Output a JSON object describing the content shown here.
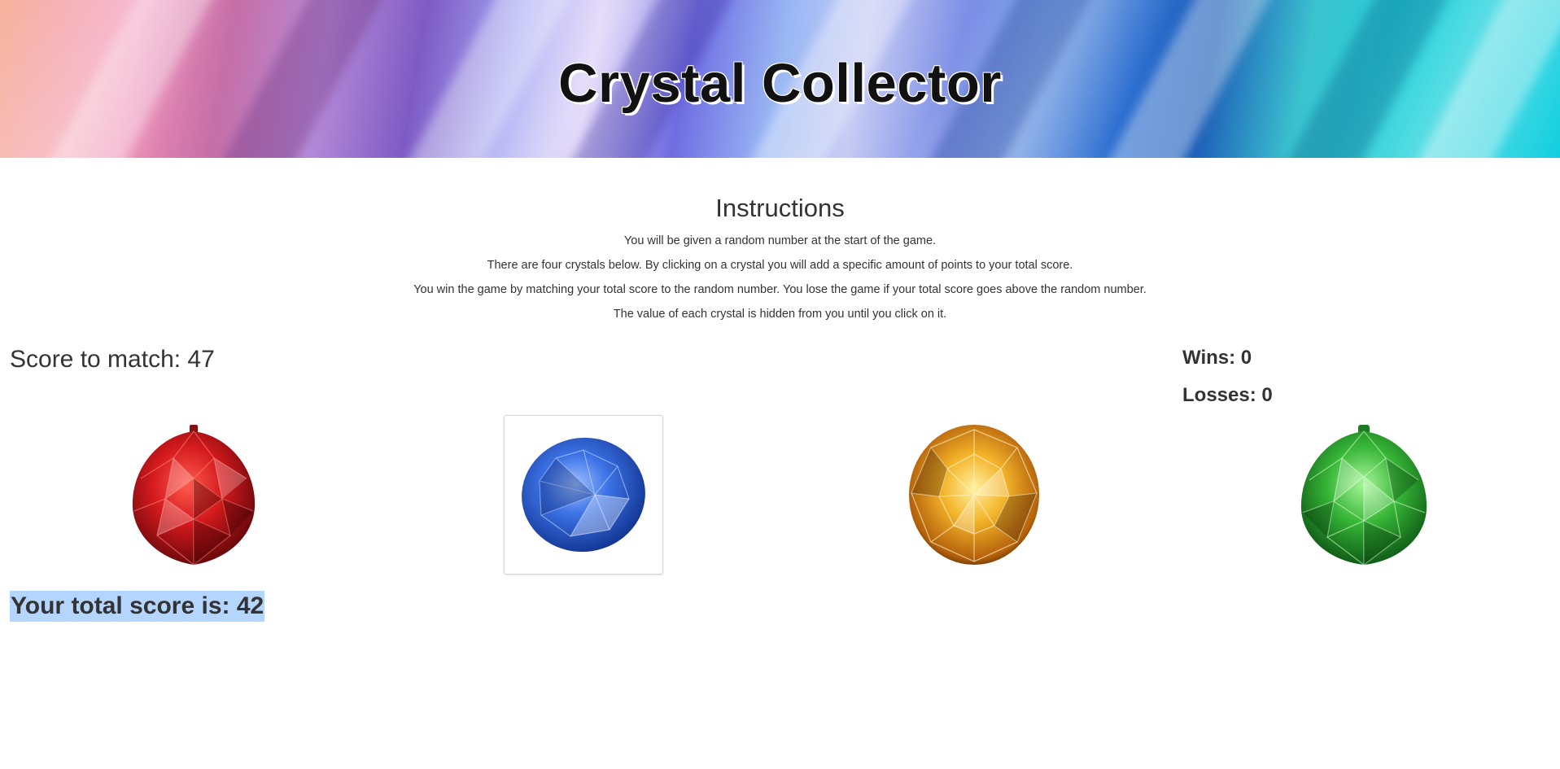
{
  "header": {
    "title": "Crystal Collector"
  },
  "instructions": {
    "heading": "Instructions",
    "lines": [
      "You will be given a random number at the start of the game.",
      "There are four crystals below. By clicking on a crystal you will add a specific amount of points to your total score.",
      "You win the game by matching your total score to the random number. You lose the game if your total score goes above the random number.",
      "The value of each crystal is hidden from you until you click on it."
    ]
  },
  "scoreboard": {
    "target_label": "Score to match: 47",
    "wins_label": "Wins: 0",
    "losses_label": "Losses: 0",
    "total_label": "Your total score is: 42"
  },
  "crystals": [
    {
      "name": "red-crystal",
      "color": "#c81418"
    },
    {
      "name": "blue-crystal",
      "color": "#2a5fd6"
    },
    {
      "name": "yellow-crystal",
      "color": "#f0a418"
    },
    {
      "name": "green-crystal",
      "color": "#2fa832"
    }
  ],
  "colors": {
    "selection_highlight": "#b4d5fe",
    "text": "#333333"
  }
}
